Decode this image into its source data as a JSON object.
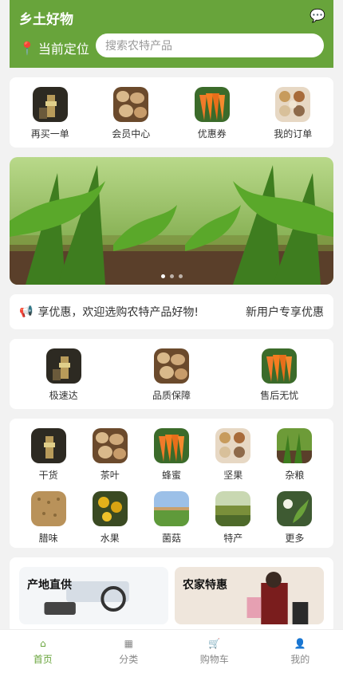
{
  "header": {
    "brand": "乡土好物",
    "location_label": "当前定位",
    "search_placeholder": "搜索农特产品",
    "chat_icon": "chat-icon",
    "pin_icon": "location-pin-icon"
  },
  "quick_links": [
    {
      "label": "再买一单",
      "icon": "reorder-icon"
    },
    {
      "label": "会员中心",
      "icon": "member-center-icon"
    },
    {
      "label": "优惠券",
      "icon": "coupon-icon"
    },
    {
      "label": "我的订单",
      "icon": "orders-icon"
    }
  ],
  "banner": {
    "dots_count": 3,
    "active_index": 0
  },
  "notice": {
    "text": "享优惠，欢迎选购农特产品好物!",
    "tag": "新用户专享优惠",
    "icon": "speaker-icon"
  },
  "services": [
    {
      "label": "极速达",
      "icon": "fast-delivery-icon"
    },
    {
      "label": "品质保障",
      "icon": "quality-icon"
    },
    {
      "label": "售后无忧",
      "icon": "after-sales-icon"
    }
  ],
  "categories": [
    {
      "label": "干货"
    },
    {
      "label": "茶叶"
    },
    {
      "label": "蜂蜜"
    },
    {
      "label": "坚果"
    },
    {
      "label": "杂粮"
    },
    {
      "label": "腊味"
    },
    {
      "label": "水果"
    },
    {
      "label": "菌菇"
    },
    {
      "label": "特产"
    },
    {
      "label": "更多"
    }
  ],
  "promos": [
    {
      "title": "产地直供"
    },
    {
      "title": "农家特惠"
    }
  ],
  "tabbar": [
    {
      "label": "首页",
      "icon": "home-icon",
      "active": true
    },
    {
      "label": "分类",
      "icon": "category-icon",
      "active": false
    },
    {
      "label": "购物车",
      "icon": "cart-icon",
      "active": false
    },
    {
      "label": "我的",
      "icon": "profile-icon",
      "active": false
    }
  ],
  "colors": {
    "brand_green": "#68a43b"
  }
}
